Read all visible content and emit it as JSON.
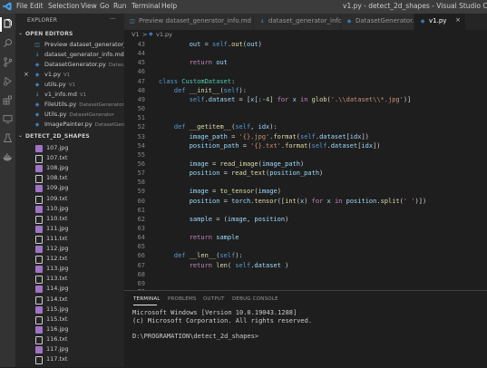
{
  "window": {
    "title": "v1.py - detect_2d_shapes - Visual Studio Code",
    "menu": [
      "File",
      "Edit",
      "Selection",
      "View",
      "Go",
      "Run",
      "Terminal",
      "Help"
    ]
  },
  "sidebar": {
    "header": "EXPLORER",
    "more": "···",
    "open_editors_label": "OPEN EDITORS",
    "open_editors": [
      {
        "name": "Preview dataset_generator_...",
        "sub": "",
        "icon": "preview-icon",
        "close": ""
      },
      {
        "name": "dataset_generator_info.md...",
        "sub": "",
        "icon": "markdown-icon",
        "close": ""
      },
      {
        "name": "DatasetGenerator.py",
        "sub": "Datas...",
        "icon": "python-icon",
        "close": ""
      },
      {
        "name": "v1.py",
        "sub": "V1",
        "icon": "python-icon",
        "close": "×"
      },
      {
        "name": "utils.py",
        "sub": "V1",
        "icon": "python-icon",
        "close": ""
      },
      {
        "name": "v1_info.md",
        "sub": "V1",
        "icon": "markdown-icon",
        "close": ""
      },
      {
        "name": "FileUtils.py",
        "sub": "DatasetGenerator",
        "icon": "python-icon",
        "close": ""
      },
      {
        "name": "Utils.py",
        "sub": "DatasetGenerator",
        "icon": "python-icon",
        "close": ""
      },
      {
        "name": "ImagePainter.py",
        "sub": "DatasetGener...",
        "icon": "python-icon",
        "close": ""
      }
    ],
    "folder_label": "DETECT_2D_SHAPES",
    "files": [
      "107.jpg",
      "107.txt",
      "108.jpg",
      "108.txt",
      "109.jpg",
      "109.txt",
      "110.jpg",
      "110.txt",
      "111.jpg",
      "111.txt",
      "112.jpg",
      "112.txt",
      "113.jpg",
      "113.txt",
      "114.jpg",
      "114.txt",
      "115.jpg",
      "115.txt",
      "116.jpg",
      "116.txt",
      "117.jpg",
      "117.txt"
    ]
  },
  "tabs": [
    {
      "label": "Preview dataset_generator_info.md",
      "icon": "preview-icon",
      "active": false
    },
    {
      "label": "dataset_generator_info.md",
      "icon": "markdown-icon",
      "active": false
    },
    {
      "label": "DatasetGenerator.py",
      "icon": "python-icon",
      "active": false
    },
    {
      "label": "v1.py",
      "icon": "python-icon",
      "active": true,
      "close": "×"
    }
  ],
  "breadcrumb": {
    "folder": "V1",
    "sep": ">",
    "file": "v1.py"
  },
  "code": {
    "lines": [
      {
        "n": "43",
        "t": "        out = self.out(out)"
      },
      {
        "n": "44",
        "t": ""
      },
      {
        "n": "45",
        "t": "        return out"
      },
      {
        "n": "46",
        "t": ""
      },
      {
        "n": "47",
        "t": "class CustomDataset:"
      },
      {
        "n": "48",
        "t": "    def __init__(self):"
      },
      {
        "n": "49",
        "t": "        self.dataset = [x[:-4] for x in glob('.\\\\dataset\\\\*.jpg')]"
      },
      {
        "n": "50",
        "t": ""
      },
      {
        "n": "51",
        "t": ""
      },
      {
        "n": "52",
        "t": "    def __getitem__(self, idx):"
      },
      {
        "n": "53",
        "t": "        image_path = '{}.jpg'.format(self.dataset[idx])"
      },
      {
        "n": "54",
        "t": "        position_path = '{}.txt'.format(self.dataset[idx])"
      },
      {
        "n": "55",
        "t": ""
      },
      {
        "n": "56",
        "t": "        image = read_image(image_path)"
      },
      {
        "n": "57",
        "t": "        position = read_text(position_path)"
      },
      {
        "n": "58",
        "t": ""
      },
      {
        "n": "59",
        "t": "        image = to_tensor(image)"
      },
      {
        "n": "60",
        "t": "        position = torch.tensor([int(x) for x in position.split(' ')])"
      },
      {
        "n": "61",
        "t": ""
      },
      {
        "n": "62",
        "t": "        sample = (image, position)"
      },
      {
        "n": "63",
        "t": ""
      },
      {
        "n": "64",
        "t": "        return sample"
      },
      {
        "n": "65",
        "t": ""
      },
      {
        "n": "66",
        "t": "    def __len__(self):"
      },
      {
        "n": "67",
        "t": "        return len( self.dataset )"
      },
      {
        "n": "68",
        "t": ""
      },
      {
        "n": "69",
        "t": ""
      }
    ],
    "extra_numbers": [
      "70",
      "71"
    ]
  },
  "panel": {
    "tabs": [
      "TERMINAL",
      "PROBLEMS",
      "OUTPUT",
      "DEBUG CONSOLE"
    ],
    "terminal_lines": [
      "Microsoft Windows [Version 10.0.19043.1288]",
      "(c) Microsoft Corporation. All rights reserved.",
      "",
      "D:\\PROGRAMATION\\detect_2d_shapes>"
    ]
  },
  "colors": {
    "accent": "#007acc",
    "python": "#3d7ab8",
    "markdown": "#519aba",
    "jpg": "#a074c4",
    "txt": "#cccccc"
  }
}
